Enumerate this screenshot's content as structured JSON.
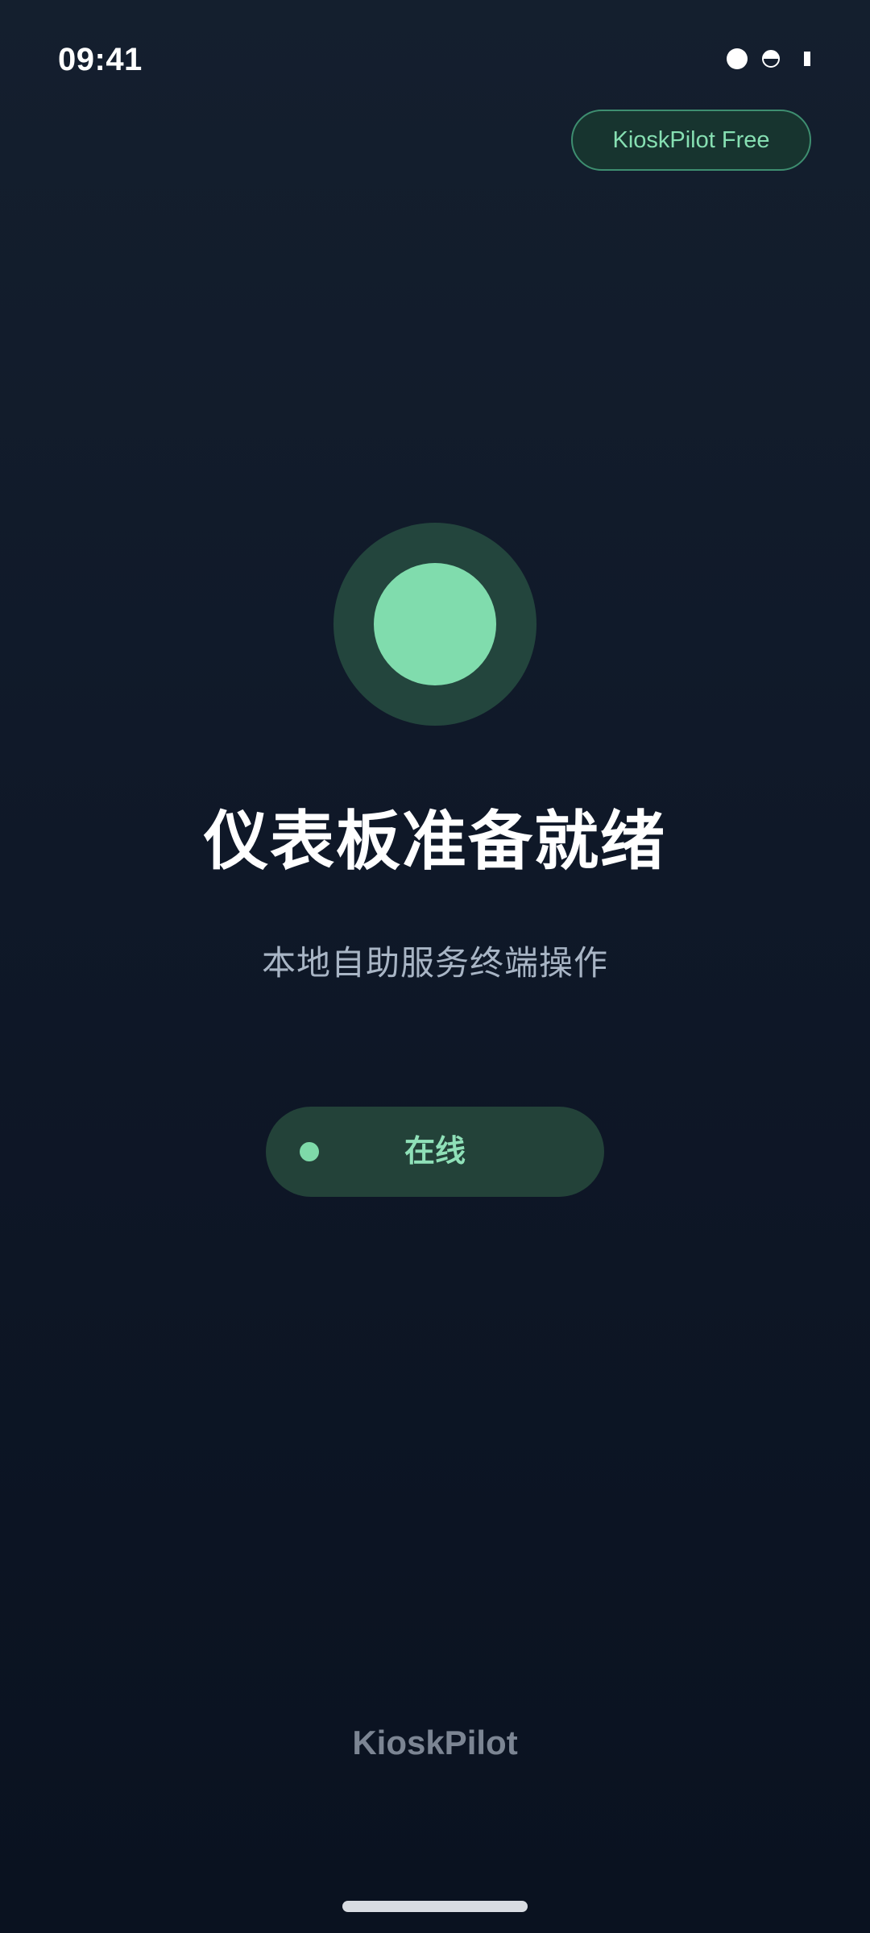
{
  "status_bar": {
    "time": "09:41",
    "icons": [
      "signal-dot-icon",
      "half-circle-icon",
      "battery-icon"
    ]
  },
  "badge": {
    "label": "KioskPilot Free"
  },
  "main": {
    "status_indicator_icon": "status-circle-icon",
    "title": "仪表板准备就绪",
    "subtitle": "本地自助服务终端操作",
    "status_pill": {
      "label": "在线",
      "dot_icon": "online-dot-icon"
    }
  },
  "footer": {
    "brand": "KioskPilot"
  },
  "colors": {
    "background_top": "#141f2e",
    "background_bottom": "#0a1220",
    "accent": "#80dcad",
    "accent_dark": "#23453d",
    "title": "#ffffff",
    "subtitle": "#a8b5c5",
    "footer": "#7c8593"
  }
}
